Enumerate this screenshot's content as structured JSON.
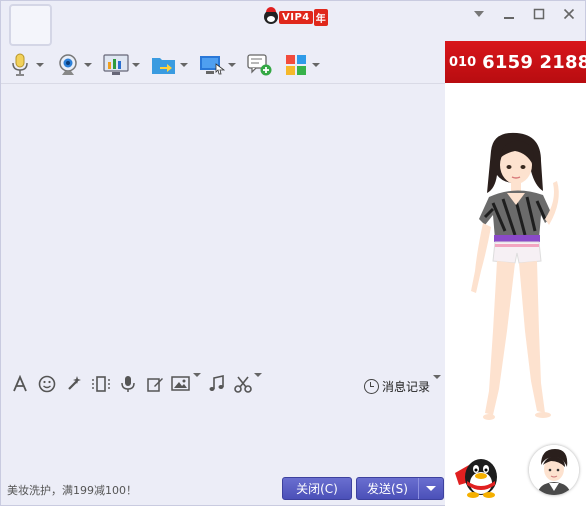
{
  "titlebar": {
    "vip_text": "VIP4",
    "vip_year": "年",
    "controls": [
      "dropdown-icon",
      "minimize-icon",
      "maximize-icon",
      "close-icon"
    ]
  },
  "toolbar": {
    "items": [
      {
        "name": "voice-call",
        "icon": "microphone-icon"
      },
      {
        "name": "video-call",
        "icon": "webcam-icon"
      },
      {
        "name": "remote-desktop",
        "icon": "monitor-icon"
      },
      {
        "name": "send-file",
        "icon": "folder-icon"
      },
      {
        "name": "screen-share",
        "icon": "screen-share-icon"
      },
      {
        "name": "create-discussion",
        "icon": "chat-add-icon"
      },
      {
        "name": "apps",
        "icon": "apps-grid-icon"
      }
    ]
  },
  "input_toolbar": {
    "items": [
      "font-icon",
      "emoji-icon",
      "magic-wand-icon",
      "shake-icon",
      "voice-message-icon",
      "edit-icon",
      "image-icon",
      "music-icon",
      "scissors-icon"
    ],
    "history_label": "消息记录"
  },
  "bottom": {
    "ad_text": "美妆洗护，满199减100！",
    "close_label": "关闭(C)",
    "send_label": "发送(S)"
  },
  "right_panel": {
    "phone_prefix": "010",
    "phone_number": "6159 2188"
  },
  "colors": {
    "window_bg": "#ecedf7",
    "button_bg": "#5055bf",
    "ad_red": "#d8161b"
  }
}
